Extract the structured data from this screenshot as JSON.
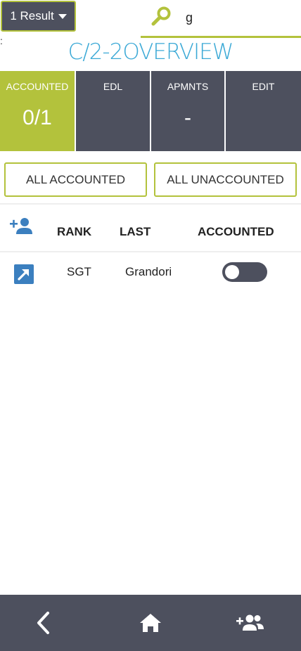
{
  "header": {
    "result_button": "1 Result",
    "search_value": "g",
    "colon": ":",
    "title": "C/2-2OVERVIEW"
  },
  "tiles": [
    {
      "label": "ACCOUNTED",
      "value": "0/1"
    },
    {
      "label": "EDL",
      "value": ""
    },
    {
      "label": "APMNTS",
      "value": "-"
    },
    {
      "label": "EDIT",
      "value": ""
    }
  ],
  "filters": {
    "all_accounted": "ALL ACCOUNTED",
    "all_unaccounted": "ALL UNACCOUNTED"
  },
  "table": {
    "columns": [
      "RANK",
      "LAST",
      "ACCOUNTED"
    ],
    "rows": [
      {
        "rank": "SGT",
        "last": "Grandori",
        "accounted": false
      }
    ]
  },
  "colors": {
    "accent": "#b3c23c",
    "dark": "#4d505e",
    "title": "#3ba9d6",
    "icon_blue": "#3b7fbf"
  },
  "icons": {
    "search": "search-icon",
    "add_person": "person-add-icon",
    "open": "open-in-new-icon",
    "back": "chevron-left-icon",
    "home": "home-icon",
    "add_group": "group-add-icon"
  }
}
